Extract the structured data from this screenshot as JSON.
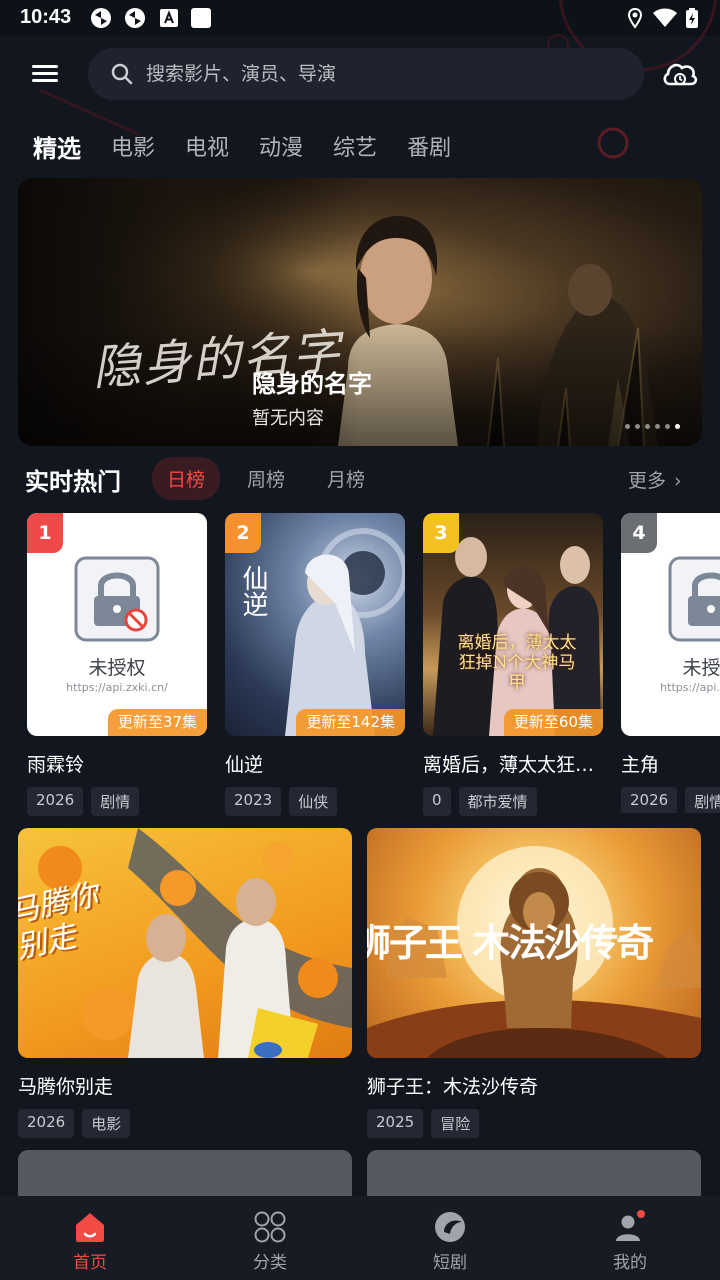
{
  "status_bar": {
    "time": "10:43"
  },
  "search": {
    "placeholder": "搜索影片、演员、导演"
  },
  "tabs": [
    {
      "label": "精选",
      "active": true
    },
    {
      "label": "电影"
    },
    {
      "label": "电视"
    },
    {
      "label": "动漫"
    },
    {
      "label": "综艺"
    },
    {
      "label": "番剧"
    }
  ],
  "banner": {
    "title": "隐身的名字",
    "subtitle": "暂无内容",
    "calligraphy": "隐身的名字",
    "dots": 6,
    "active_dot": 6
  },
  "hot": {
    "title": "实时热门",
    "tabs": [
      "日榜",
      "周榜",
      "月榜"
    ],
    "more_label": "更多",
    "items": [
      {
        "rank": "1",
        "badge_color": "#ef4a4a",
        "name": "雨霖铃",
        "update": "更新至37集",
        "tags": [
          "2026",
          "剧情"
        ],
        "unauthorized": true,
        "lock_text": "未授权",
        "lock_url": "https://api.zxki.cn/"
      },
      {
        "rank": "2",
        "badge_color": "#f5912e",
        "name": "仙逆",
        "update": "更新至142集",
        "tags": [
          "2023",
          "仙侠"
        ]
      },
      {
        "rank": "3",
        "badge_color": "#f3c21e",
        "name": "离婚后，薄太太狂…",
        "update": "更新至60集",
        "tags": [
          "0",
          "都市爱情"
        ]
      },
      {
        "rank": "4",
        "badge_color": "#6b6e73",
        "name": "主角",
        "update": "",
        "tags": [
          "2026",
          "剧情"
        ],
        "unauthorized": true,
        "lock_text": "未授权",
        "lock_url": "https://api.zxki.cn/"
      }
    ]
  },
  "poster_texts": {
    "xianni": "仙逆",
    "lihun": "离婚后，薄太太狂掉N个大神马甲",
    "mateng": "马腾你别走",
    "shizi": "狮子王 木法沙传奇"
  },
  "grid": [
    {
      "name": "马腾你别走",
      "tags": [
        "2026",
        "电影"
      ]
    },
    {
      "name": "狮子王：木法沙传奇",
      "tags": [
        "2025",
        "冒险"
      ]
    }
  ],
  "nav": [
    {
      "label": "首页",
      "icon": "home-icon",
      "active": true
    },
    {
      "label": "分类",
      "icon": "category-icon"
    },
    {
      "label": "短剧",
      "icon": "short-drama-icon"
    },
    {
      "label": "我的",
      "icon": "profile-icon"
    }
  ],
  "colors": {
    "accent": "#f24b44",
    "background": "#12161f",
    "update_badge": "#f59628"
  }
}
